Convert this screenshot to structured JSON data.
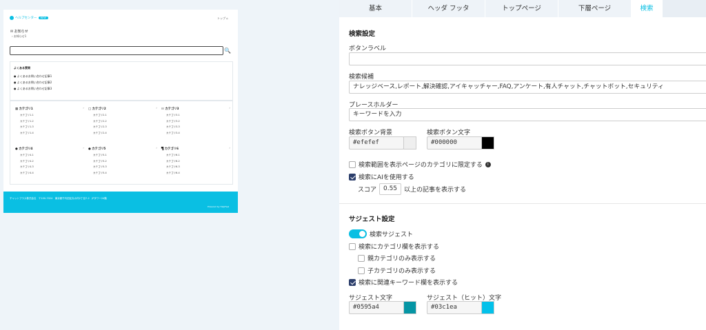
{
  "preview": {
    "logo_text": "ヘルプセンター",
    "logo_badge": "NEW",
    "home_link": "トップ",
    "notice_title": "お知らせ",
    "notice_item": "お知らせ1",
    "faq_title": "よくある質問",
    "faq_items": [
      "よくあるお問い合わせ記事1",
      "よくあるお問い合わせ記事2",
      "よくあるお問い合わせ記事3"
    ],
    "categories": [
      {
        "title": "カテゴリ1",
        "subs": [
          "カテゴリ1-1",
          "カテゴリ1-2",
          "カテゴリ1-3",
          "カテゴリ1-4"
        ]
      },
      {
        "title": "カテゴリ2",
        "subs": [
          "カテゴリ2-1",
          "カテゴリ2-2",
          "カテゴリ2-3",
          "カテゴリ2-4"
        ]
      },
      {
        "title": "カテゴリ3",
        "subs": [
          "カテゴリ3-1",
          "カテゴリ3-2",
          "カテゴリ3-3",
          "カテゴリ3-4"
        ]
      },
      {
        "title": "カテゴリ4",
        "subs": [
          "カテゴリ4-1",
          "カテゴリ4-2",
          "カテゴリ4-3",
          "カテゴリ4-4"
        ]
      },
      {
        "title": "カテゴリ5",
        "subs": [
          "カテゴリ5-1",
          "カテゴリ5-2",
          "カテゴリ5-3",
          "カテゴリ5-4"
        ]
      },
      {
        "title": "カテゴリ6",
        "subs": [
          "カテゴリ6-1",
          "カテゴリ6-2",
          "カテゴリ6-3",
          "カテゴリ6-4"
        ]
      }
    ],
    "footer_address": "チャットプラス株式会社　〒100-7024　東京都千代田区丸の内2丁目7-2　JPタワー24階",
    "footer_powered": "Powered by HelpFeel",
    "brand_color": "#0abfe3"
  },
  "tabs": [
    "基本",
    "ヘッダ フッタ",
    "トップページ",
    "下層ページ",
    "検索"
  ],
  "active_tab": "検索",
  "search_settings": {
    "section_title": "検索設定",
    "button_label_label": "ボタンラベル",
    "button_label_value": "",
    "candidates_label": "検索候補",
    "candidates_value": "ナレッジベース,レポート,解決確認,アイキャッチャー,FAQ,アンケート,有人チャット,チャットボット,セキュリティ",
    "placeholder_label": "プレースホルダー",
    "placeholder_value": "キーワードを入力",
    "btn_bg_label": "検索ボタン背景",
    "btn_bg_value": "#efefef",
    "btn_text_label": "検索ボタン文字",
    "btn_text_value": "#000000",
    "limit_category_label": "検索範囲を表示ページのカテゴリに限定する",
    "use_ai_label": "検索にAIを使用する",
    "score_prefix": "スコア",
    "score_value": "0.55",
    "score_suffix": "以上の記事を表示する"
  },
  "suggest_settings": {
    "section_title": "サジェスト設定",
    "search_suggest_label": "検索サジェスト",
    "show_category_label": "検索にカテゴリ欄を表示する",
    "parent_only_label": "親カテゴリのみ表示する",
    "child_only_label": "子カテゴリのみ表示する",
    "related_keyword_label": "検索に関連キーワード欄を表示する",
    "suggest_text_label": "サジェスト文字",
    "suggest_text_value": "#0595a4",
    "suggest_hit_label": "サジェスト（ヒット）文字",
    "suggest_hit_value": "#03c1ea"
  }
}
